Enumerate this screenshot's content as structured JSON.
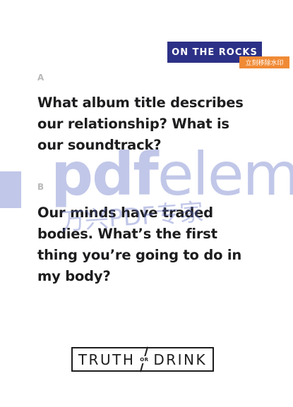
{
  "card": {
    "tag_label": "ON THE ROCKS",
    "watermark_remove_label": "立刻移除水印",
    "questions": [
      {
        "label": "A",
        "text": "What album title describes our relationship? What is our soundtrack?"
      },
      {
        "label": "B",
        "text": "Our minds have traded bodies. What’s the first thing you’re going to do in my body?"
      }
    ]
  },
  "watermark": {
    "main_bold": "pdf",
    "main_light": "eleme",
    "sub": "万兴PDF专家"
  },
  "logo": {
    "left": "TRUTH",
    "middle": "OR",
    "right": "DRINK"
  },
  "colors": {
    "tag_bg": "#2c3187",
    "remove_bg": "#f08a35",
    "watermark": "#5f6dc4",
    "text": "#1d1d1f",
    "label": "#b9b9b9"
  }
}
